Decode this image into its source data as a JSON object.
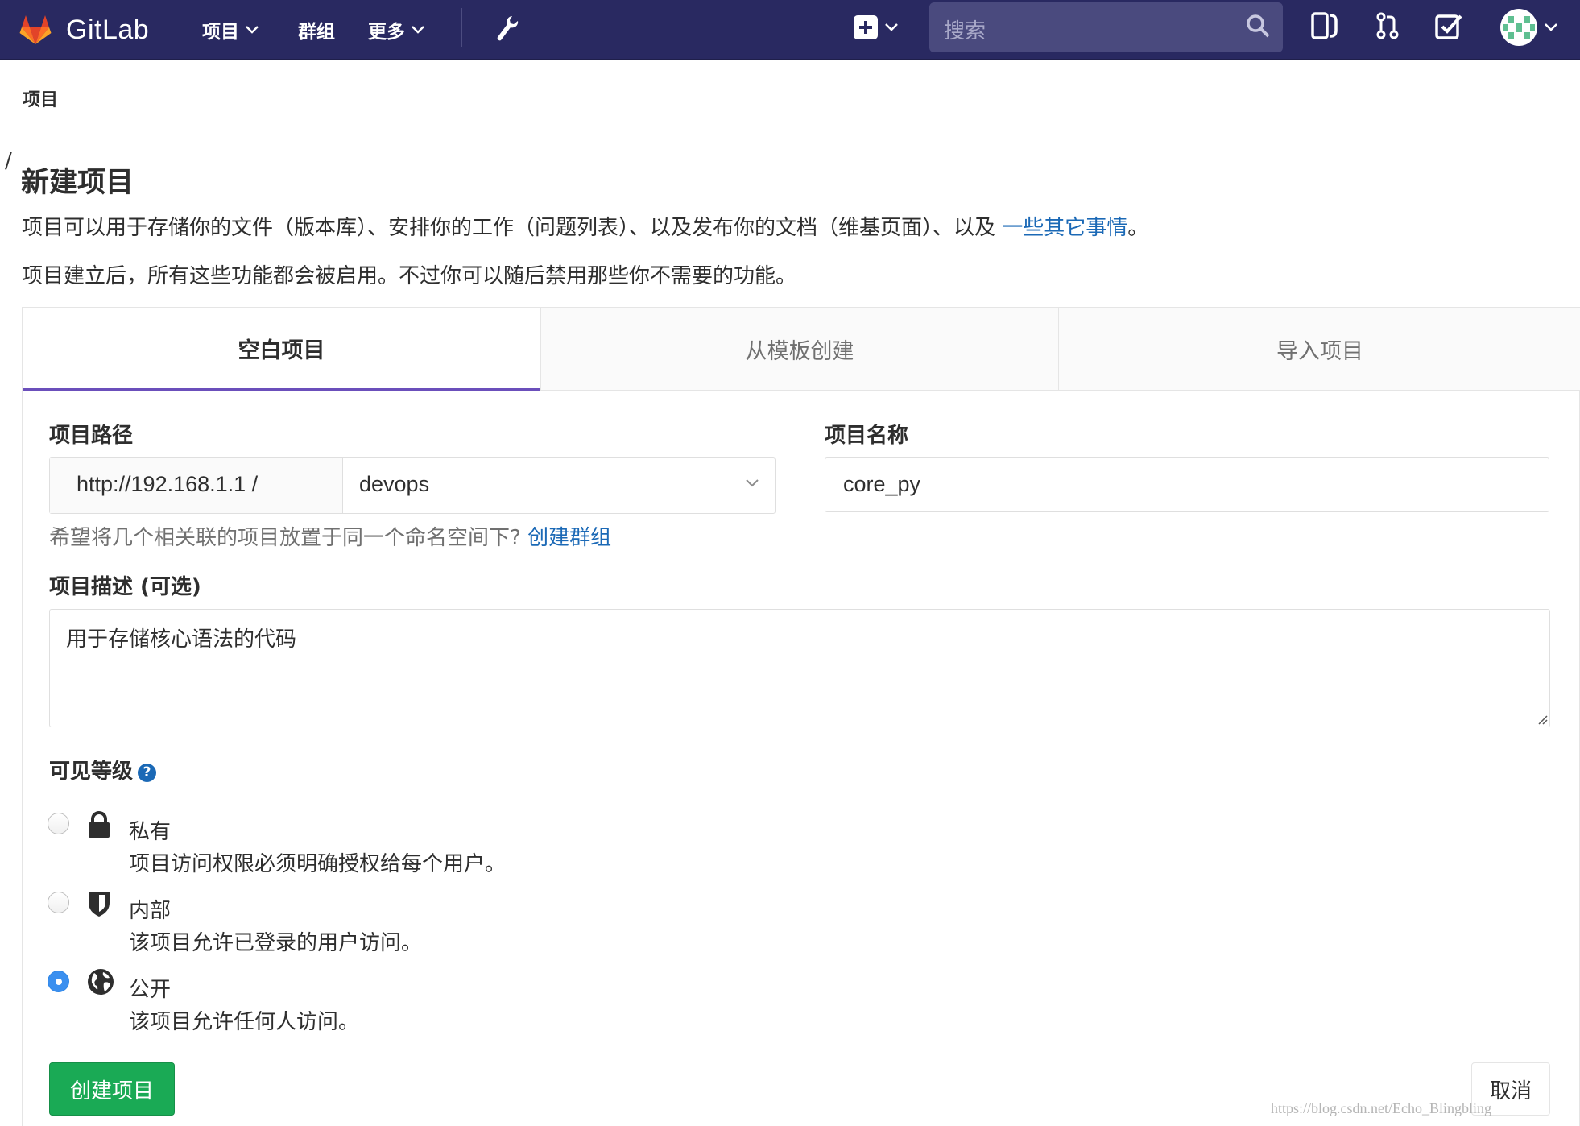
{
  "navbar": {
    "brand": "GitLab",
    "links": [
      {
        "label": "项目",
        "has_dropdown": true
      },
      {
        "label": "群组",
        "has_dropdown": false
      },
      {
        "label": "更多",
        "has_dropdown": true
      }
    ],
    "search_placeholder": "搜索",
    "icons": [
      "wrench-icon",
      "plus-square-icon",
      "search-icon",
      "sidebar-toggle-icon",
      "merge-request-icon",
      "todo-check-icon",
      "avatar"
    ],
    "colors": {
      "background": "#292961",
      "search_bg": "#4a4a7e"
    }
  },
  "breadcrumb": {
    "item": "项目"
  },
  "page": {
    "slash": "/",
    "title": "新建项目",
    "intro_line1": "项目可以用于存储你的文件（版本库）、安排你的工作（问题列表）、以及发布你的文档（维基页面）、以及 ",
    "intro_link": "一些其它事情",
    "intro_line1_end": "。",
    "intro_line2": "项目建立后，所有这些功能都会被启用。不过你可以随后禁用那些你不需要的功能。"
  },
  "tabs": [
    {
      "label": "空白项目",
      "active": true
    },
    {
      "label": "从模板创建",
      "active": false
    },
    {
      "label": "导入项目",
      "active": false
    }
  ],
  "form": {
    "path_label": "项目路径",
    "path_prefix": "http://192.168.1.1 /",
    "namespace_value": "devops",
    "name_label": "项目名称",
    "name_value": "core_py",
    "help_text": "希望将几个相关联的项目放置于同一个命名空间下? ",
    "help_link": "创建群组",
    "desc_label": "项目描述 (可选)",
    "desc_value": "用于存储核心语法的代码",
    "visibility_label": "可见等级",
    "visibility_help": "?",
    "visibility_options": [
      {
        "title": "私有",
        "desc": "项目访问权限必须明确授权给每个用户。",
        "icon": "lock-icon",
        "checked": false
      },
      {
        "title": "内部",
        "desc": "该项目允许已登录的用户访问。",
        "icon": "shield-icon",
        "checked": false
      },
      {
        "title": "公开",
        "desc": "该项目允许任何人访问。",
        "icon": "globe-icon",
        "checked": true
      }
    ],
    "create_button": "创建项目",
    "cancel_button": "取消"
  },
  "colors": {
    "accent": "#6b4fbb",
    "link": "#1b69b6",
    "success": "#1aaa55",
    "radio_checked": "#3a8fef"
  },
  "watermark": "https://blog.csdn.net/Echo_Blingbling"
}
